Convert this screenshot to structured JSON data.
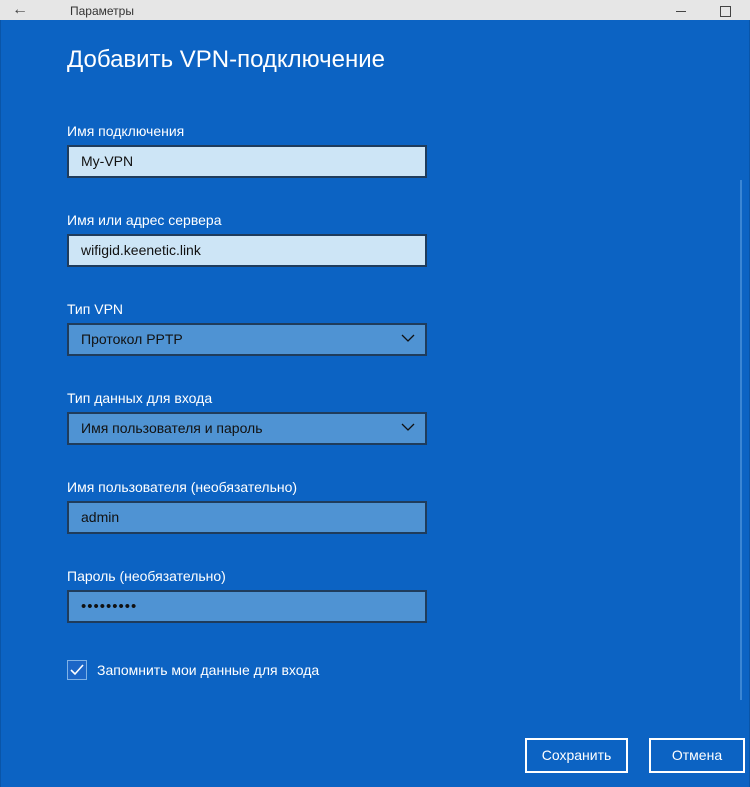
{
  "window": {
    "title": "Параметры"
  },
  "dialog": {
    "heading": "Добавить VPN-подключение",
    "connection_name": {
      "label": "Имя подключения",
      "value": "My-VPN"
    },
    "server": {
      "label": "Имя или адрес сервера",
      "value": "wifigid.keenetic.link"
    },
    "vpn_type": {
      "label": "Тип VPN",
      "value": "Протокол PPTP"
    },
    "signin_type": {
      "label": "Тип данных для входа",
      "value": "Имя пользователя и пароль"
    },
    "username": {
      "label": "Имя пользователя (необязательно)",
      "value": "admin"
    },
    "password": {
      "label": "Пароль (необязательно)",
      "value": "•••••••••"
    },
    "remember": {
      "label": "Запомнить мои данные для входа",
      "checked": true
    },
    "buttons": {
      "save": "Сохранить",
      "cancel": "Отмена"
    }
  },
  "colors": {
    "dialog_background": "#0c63c3",
    "light_input": "#cde5f6",
    "dark_input": "#4f93d3"
  }
}
